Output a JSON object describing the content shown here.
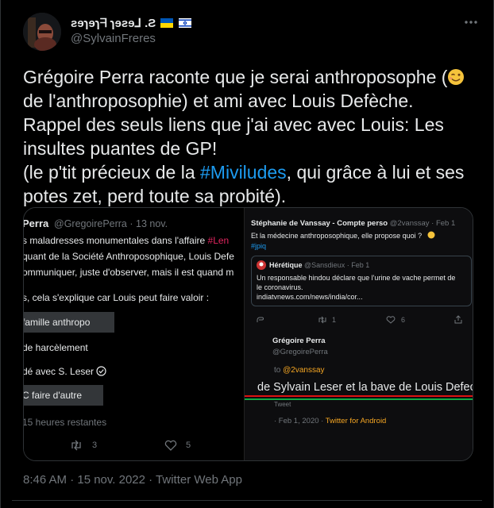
{
  "user": {
    "display_name": "ƨɘɿɘɿᖷ ɿɘƨɘ⅃ .Ƨ",
    "handle": "@SylvainFreres"
  },
  "tweet": {
    "line1a": "Grégoire Perra raconte que je serai anthroposophe (",
    "line1b": "de l'anthroposophie) et ami avec Louis Defèche.",
    "line2": "Rappel des seuls liens que j'ai avec avec Louis: Les insultes puantes de GP!",
    "line3a": " (le p'tit précieux de la ",
    "hashtag": "#Miviludes",
    "line3b": ", qui grâce à lui et ses potes zet, perd toute sa probité)."
  },
  "left_image": {
    "author": "Perra",
    "handle_time": "@GregoirePerra · 13 nov.",
    "text1a": "s maladresses monumentales dans l'affaire ",
    "text1_tag": "#Len",
    "text2": "quant de la Société Anthroposophique, Louis Defe",
    "text3": "ommuniquer, juste d'observer, mais il est quand m",
    "text4": "s, cela s'explique car Louis peut faire valoir :",
    "poll": [
      {
        "label": " famille anthropo"
      },
      {
        "label": " de harcèlement"
      },
      {
        "label": "dé avec S. Leser"
      },
      {
        "label": "C faire d'autre"
      }
    ],
    "time_left": " 15 heures restantes",
    "retweets": "3",
    "likes": "5"
  },
  "right_image": {
    "author1": "Stéphanie de Vanssay - Compte perso",
    "handle1": "@2vanssay · Feb 1",
    "text1": "Et la médecine anthroposophique, elle propose quoi ?",
    "tag1": "#jpiq",
    "quote_author": "Hérétique",
    "quote_handle": "@Sansdieux · Feb 1",
    "quote_text1": "Un responsable hindou déclare que l'urine de vache permet de",
    "quote_text2": "le coronavirus.",
    "quote_link": "indiatvnews.com/news/india/cor...",
    "stat_rt": "1",
    "stat_like": "6",
    "author2": "Grégoire Perra",
    "handle2": "@GregoirePerra",
    "reply_to": "to ",
    "reply_handle": "@2vanssay",
    "big_text": " de Sylvain Leser et la bave de Louis Defech",
    "tweet_label": "Tweet",
    "meta": "· Feb 1, 2020 · ",
    "client": "Twitter for Android"
  },
  "footer": {
    "timestamp": "8:46 AM · 15 nov. 2022 · Twitter Web App"
  }
}
